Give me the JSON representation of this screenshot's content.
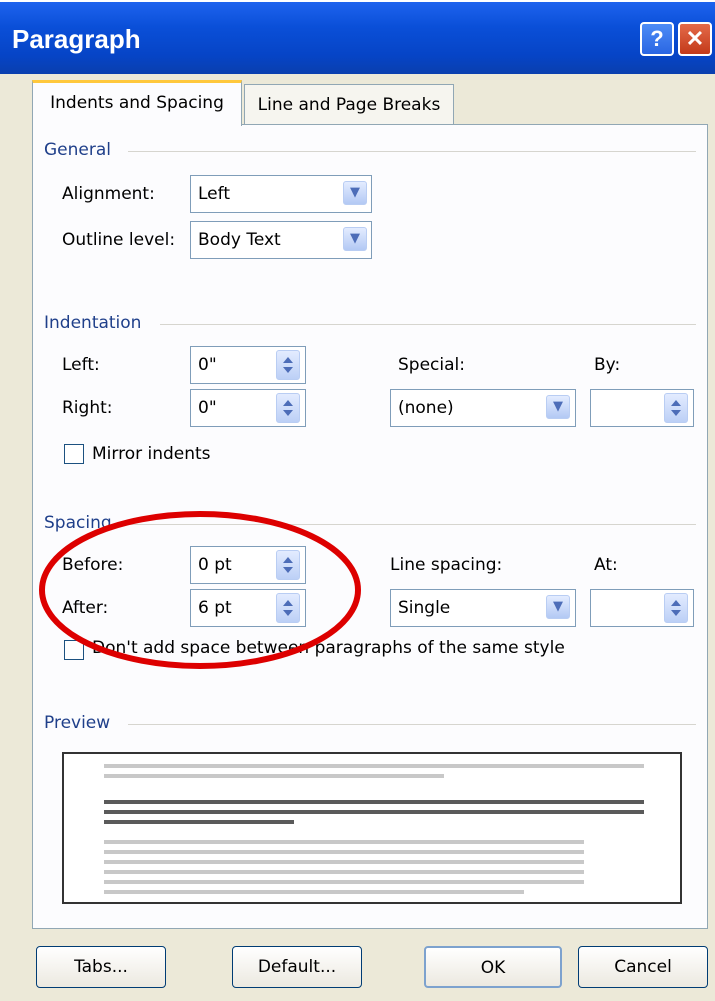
{
  "window": {
    "title": "Paragraph",
    "help_icon": "?",
    "close_icon": "✕"
  },
  "tabs": [
    {
      "label": "Indents and Spacing",
      "active": true
    },
    {
      "label": "Line and Page Breaks",
      "active": false
    }
  ],
  "general": {
    "heading": "General",
    "alignment_label": "Alignment:",
    "alignment_value": "Left",
    "outline_label": "Outline level:",
    "outline_value": "Body Text"
  },
  "indentation": {
    "heading": "Indentation",
    "left_label": "Left:",
    "left_value": "0\"",
    "right_label": "Right:",
    "right_value": "0\"",
    "special_label": "Special:",
    "special_value": "(none)",
    "by_label": "By:",
    "by_value": "",
    "mirror_label": "Mirror indents",
    "mirror_checked": false
  },
  "spacing": {
    "heading": "Spacing",
    "before_label": "Before:",
    "before_value": "0 pt",
    "after_label": "After:",
    "after_value": "6 pt",
    "line_spacing_label": "Line spacing:",
    "line_spacing_value": "Single",
    "at_label": "At:",
    "at_value": "",
    "dont_add_label": "Don't add space between paragraphs of the same style",
    "dont_add_checked": false
  },
  "preview": {
    "heading": "Preview"
  },
  "buttons": {
    "tabs": "Tabs...",
    "default": "Default...",
    "ok": "OK",
    "cancel": "Cancel"
  },
  "colors": {
    "titlebar": "#0a4fd8",
    "dialog_bg": "#ece9d8",
    "section_heading": "#1f3f8a",
    "annotation": "#dd0000"
  }
}
